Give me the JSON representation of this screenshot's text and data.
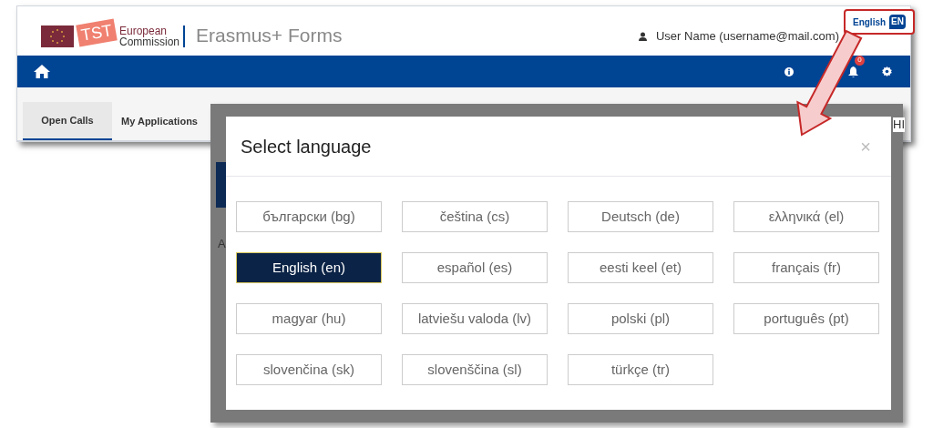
{
  "header": {
    "logo": {
      "ribbon": "TST",
      "org_line1": "European",
      "org_line2": "Commission"
    },
    "app_title": "Erasmus+ Forms",
    "user": "User Name (username@mail.com)",
    "language": {
      "label": "English",
      "code": "EN"
    }
  },
  "nav": {
    "notification_count": "0"
  },
  "tabs": [
    {
      "label": "Open Calls",
      "selected": true
    },
    {
      "label": "My Applications",
      "selected": false
    }
  ],
  "covered_text": [
    "HI",
    "A"
  ],
  "dialog": {
    "title": "Select language",
    "close": "×",
    "languages": [
      {
        "label": "български (bg)",
        "selected": false
      },
      {
        "label": "čeština (cs)",
        "selected": false
      },
      {
        "label": "Deutsch (de)",
        "selected": false
      },
      {
        "label": "ελληνικά (el)",
        "selected": false
      },
      {
        "label": "English (en)",
        "selected": true
      },
      {
        "label": "español (es)",
        "selected": false
      },
      {
        "label": "eesti keel (et)",
        "selected": false
      },
      {
        "label": "français (fr)",
        "selected": false
      },
      {
        "label": "magyar (hu)",
        "selected": false
      },
      {
        "label": "latviešu valoda (lv)",
        "selected": false
      },
      {
        "label": "polski (pl)",
        "selected": false
      },
      {
        "label": "português (pt)",
        "selected": false
      },
      {
        "label": "slovenčina (sk)",
        "selected": false
      },
      {
        "label": "slovenščina (sl)",
        "selected": false
      },
      {
        "label": "türkçe (tr)",
        "selected": false
      }
    ]
  }
}
